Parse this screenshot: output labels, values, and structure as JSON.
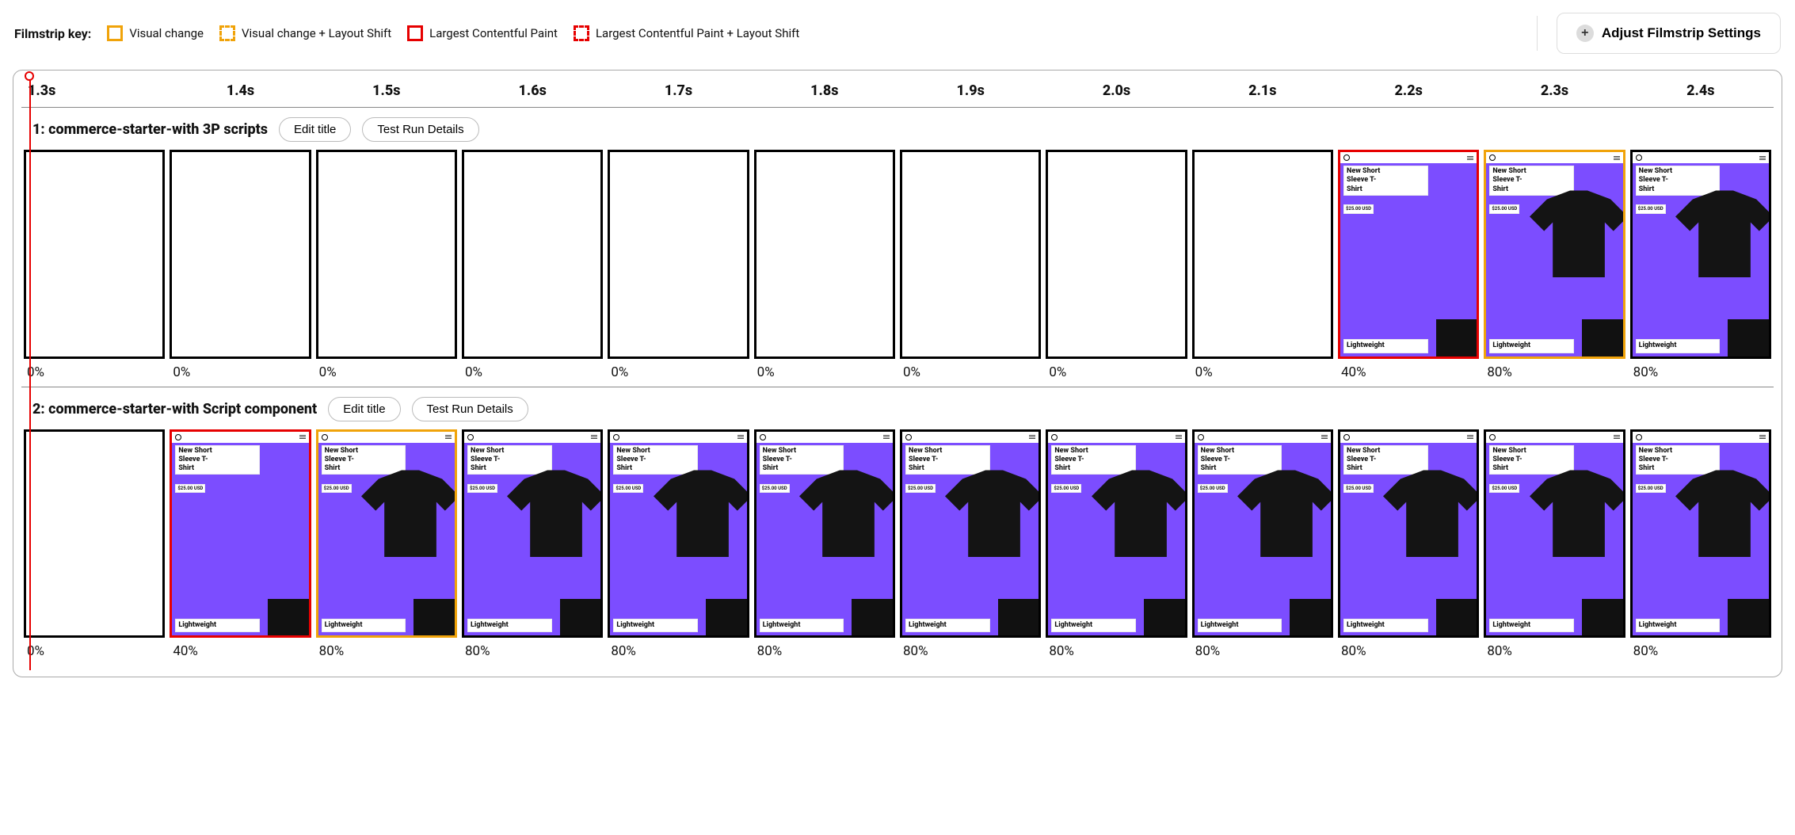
{
  "legend": {
    "label": "Filmstrip key:",
    "items": [
      {
        "text": "Visual change",
        "cls": "orange"
      },
      {
        "text": "Visual change + Layout Shift",
        "cls": "orange dashed"
      },
      {
        "text": "Largest Contentful Paint",
        "cls": "red"
      },
      {
        "text": "Largest Contentful Paint + Layout Shift",
        "cls": "red dashed"
      }
    ]
  },
  "adjust_button": "Adjust Filmstrip Settings",
  "timestamps": [
    "1.3s",
    "1.4s",
    "1.5s",
    "1.6s",
    "1.7s",
    "1.8s",
    "1.9s",
    "2.0s",
    "2.1s",
    "2.2s",
    "2.3s",
    "2.4s"
  ],
  "product": {
    "title_l1": "New Short",
    "title_l2": "Sleeve T-",
    "title_l3": "Shirt",
    "price": "$25.00 USD",
    "tag": "Lightweight"
  },
  "runs": [
    {
      "title": "1: commerce-starter-with 3P scripts",
      "edit_label": "Edit title",
      "details_label": "Test Run Details",
      "frames": [
        {
          "pct": "0%",
          "content": "blank",
          "border": "black"
        },
        {
          "pct": "0%",
          "content": "blank",
          "border": "black"
        },
        {
          "pct": "0%",
          "content": "blank",
          "border": "black"
        },
        {
          "pct": "0%",
          "content": "blank",
          "border": "black"
        },
        {
          "pct": "0%",
          "content": "blank",
          "border": "black"
        },
        {
          "pct": "0%",
          "content": "blank",
          "border": "black"
        },
        {
          "pct": "0%",
          "content": "blank",
          "border": "black"
        },
        {
          "pct": "0%",
          "content": "blank",
          "border": "black"
        },
        {
          "pct": "0%",
          "content": "blank",
          "border": "black"
        },
        {
          "pct": "40%",
          "content": "partial",
          "border": "red"
        },
        {
          "pct": "80%",
          "content": "full",
          "border": "orange"
        },
        {
          "pct": "80%",
          "content": "full",
          "border": "black"
        }
      ]
    },
    {
      "title": "2: commerce-starter-with Script component",
      "edit_label": "Edit title",
      "details_label": "Test Run Details",
      "frames": [
        {
          "pct": "0%",
          "content": "blank",
          "border": "black"
        },
        {
          "pct": "40%",
          "content": "partial",
          "border": "red"
        },
        {
          "pct": "80%",
          "content": "full",
          "border": "orange"
        },
        {
          "pct": "80%",
          "content": "full",
          "border": "black"
        },
        {
          "pct": "80%",
          "content": "full",
          "border": "black"
        },
        {
          "pct": "80%",
          "content": "full",
          "border": "black"
        },
        {
          "pct": "80%",
          "content": "full",
          "border": "black"
        },
        {
          "pct": "80%",
          "content": "full",
          "border": "black"
        },
        {
          "pct": "80%",
          "content": "full",
          "border": "black"
        },
        {
          "pct": "80%",
          "content": "full",
          "border": "black"
        },
        {
          "pct": "80%",
          "content": "full",
          "border": "black"
        },
        {
          "pct": "80%",
          "content": "full",
          "border": "black"
        }
      ]
    }
  ]
}
